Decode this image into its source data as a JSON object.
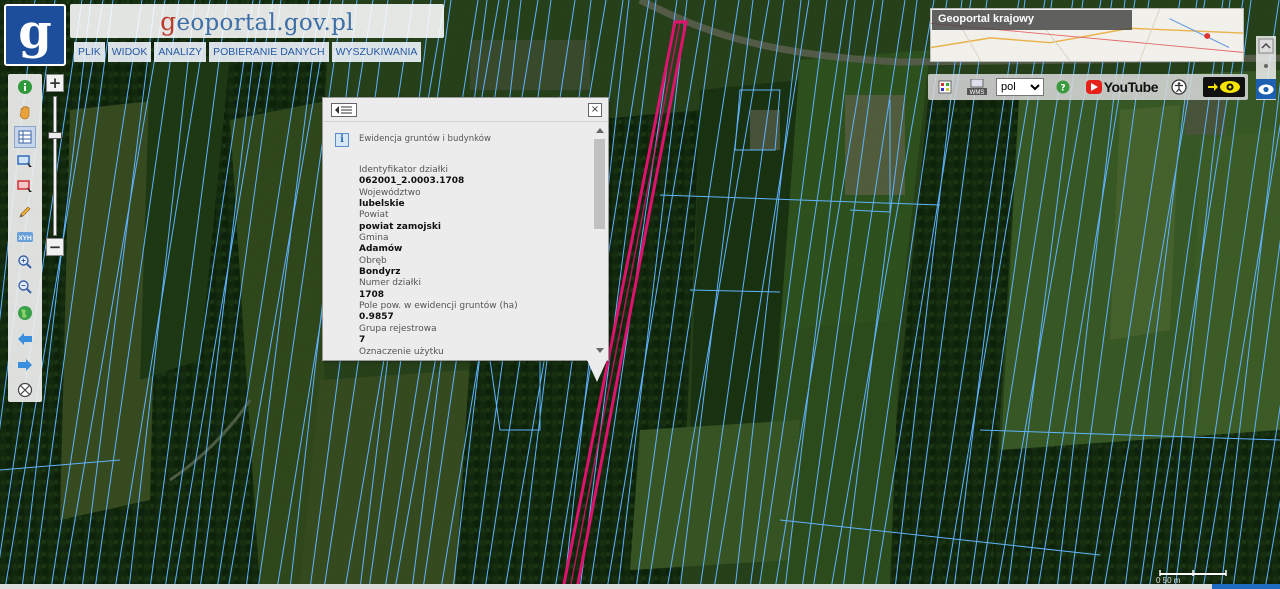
{
  "header": {
    "logo_letter": "g",
    "site_title_first": "g",
    "site_title_rest": "eoportal.gov.pl",
    "menu": [
      {
        "label": "PLIK"
      },
      {
        "label": "WIDOK"
      },
      {
        "label": "ANALIZY"
      },
      {
        "label": "POBIERANIE DANYCH"
      },
      {
        "label": "WYSZUKIWANIA"
      }
    ]
  },
  "overview": {
    "label": "Geoportal krajowy"
  },
  "top_toolbar": {
    "language": "pol",
    "language_options": [
      "pol"
    ],
    "youtube_label": "YouTube"
  },
  "left_toolbar": {
    "tools": [
      "info-icon",
      "hand-icon",
      "table-icon",
      "select-area-icon",
      "select-clear-icon",
      "pencil-icon",
      "xyh-icon",
      "zoom-in-icon",
      "zoom-out-icon",
      "globe-icon",
      "back-arrow-icon",
      "forward-arrow-icon",
      "compass-icon"
    ],
    "xyh_label": "XYH",
    "selected_tool": "table-icon",
    "zoom_plus": "+",
    "zoom_minus": "−"
  },
  "popup": {
    "close_label": "×",
    "layer_title": "Ewidencja gruntów i budynków",
    "fields": [
      {
        "label": "Identyfikator działki",
        "value": "062001_2.0003.1708"
      },
      {
        "label": "Województwo",
        "value": "lubelskie"
      },
      {
        "label": "Powiat",
        "value": "powiat zamojski"
      },
      {
        "label": "Gmina",
        "value": "Adamów"
      },
      {
        "label": "Obręb",
        "value": "Bondyrz"
      },
      {
        "label": "Numer działki",
        "value": "1708"
      },
      {
        "label": "Pole pow. w ewidencji gruntów (ha)",
        "value": "0.9857"
      },
      {
        "label": "Grupa rejestrowa",
        "value": "7"
      },
      {
        "label": "Oznaczenie użytku",
        "value": ""
      }
    ]
  },
  "scale": {
    "label": "0   50 m"
  },
  "colors": {
    "parcel_lines": "#5fb3ff",
    "selected_parcel": "#e0126e",
    "logo_blue": "#1d4e9c",
    "menu_text": "#2458a2"
  }
}
